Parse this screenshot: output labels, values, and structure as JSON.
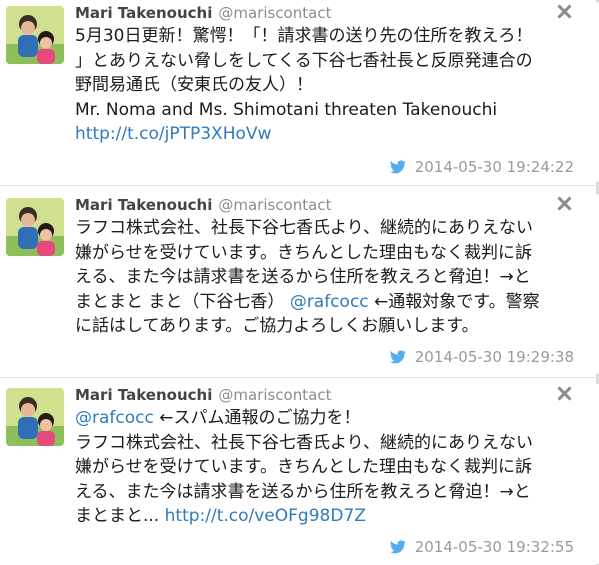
{
  "tweets": [
    {
      "name": "Mari Takenouchi",
      "handle": "@mariscontact",
      "lines": [
        [
          {
            "t": "5月30日更新！驚愕！「！請求書の送り先の住所を教えろ！"
          }
        ],
        [
          {
            "t": "」とありえない脅しをしてくる下谷七香社長と反原発連合の"
          }
        ],
        [
          {
            "t": "野間易通氏（安東氏の友人）！"
          }
        ],
        [
          {
            "t": "Mr. Noma and Ms. Shimotani threaten Takenouchi"
          }
        ],
        [
          {
            "t": "http://t.co/jPTP3XHoVw",
            "link": true
          }
        ]
      ],
      "timestamp": "2014-05-30 19:24:22"
    },
    {
      "name": "Mari Takenouchi",
      "handle": "@mariscontact",
      "lines": [
        [
          {
            "t": "ラフコ株式会社、社長下谷七香氏より、継続的にありえない"
          }
        ],
        [
          {
            "t": "嫌がらせを受けています。きちんとした理由もなく裁判に訴"
          }
        ],
        [
          {
            "t": "える、また今は請求書を送るから住所を教えろと脅迫！→と"
          }
        ],
        [
          {
            "t": "まとまと まと（下谷七香） "
          },
          {
            "t": "@rafcocc",
            "link": true
          },
          {
            "t": " ←通報対象です。警察"
          }
        ],
        [
          {
            "t": "に話はしてあります。ご協力よろしくお願いします。"
          }
        ]
      ],
      "timestamp": "2014-05-30 19:29:38"
    },
    {
      "name": "Mari Takenouchi",
      "handle": "@mariscontact",
      "lines": [
        [
          {
            "t": "@rafcocc",
            "link": true
          },
          {
            "t": " ←スパム通報のご協力を！"
          }
        ],
        [
          {
            "t": "ラフコ株式会社、社長下谷七香氏より、継続的にありえない"
          }
        ],
        [
          {
            "t": "嫌がらせを受けています。きちんとした理由もなく裁判に訴"
          }
        ],
        [
          {
            "t": "える、また今は請求書を送るから住所を教えろと脅迫！→と"
          }
        ],
        [
          {
            "t": "まとまと... "
          },
          {
            "t": "http://t.co/veOFg98D7Z",
            "link": true
          }
        ]
      ],
      "timestamp": "2014-05-30 19:32:55"
    }
  ],
  "icons": {
    "close": "close-icon",
    "timestamp": "twitter-bird-icon",
    "avatar": "avatar"
  },
  "colors": {
    "link": "#2f7bbd",
    "bird": "#55acee",
    "muted": "#9a9a9a"
  }
}
